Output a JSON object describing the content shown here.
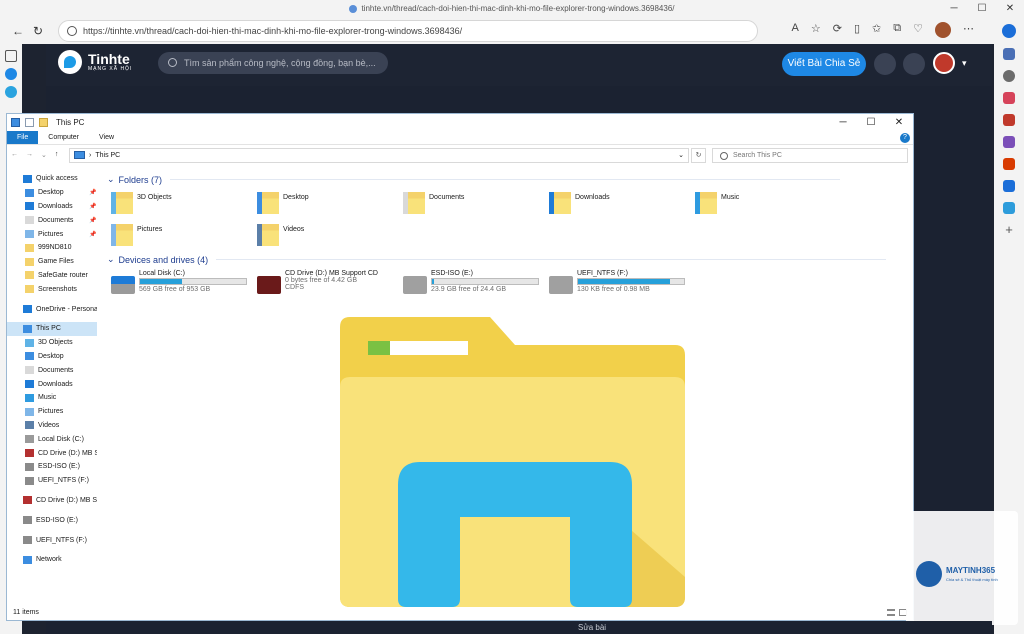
{
  "browser": {
    "tab_url_title": "tinhte.vn/thread/cach-doi-hien-thi-mac-dinh-khi-mo-file-explorer-trong-windows.3698436/",
    "address": "https://tinhte.vn/thread/cach-doi-hien-thi-mac-dinh-khi-mo-file-explorer-trong-windows.3698436/"
  },
  "site": {
    "logo_name": "Tinhte",
    "logo_tag": "MẠNG XÃ HỘI",
    "search_placeholder": "Tìm sản phẩm công nghệ, cộng đồng, bạn bè,...",
    "share_button": "Viết Bài Chia Sẻ",
    "bottom_text": "Sửa bài",
    "accent": "#1e88e5"
  },
  "explorer": {
    "title": "This PC",
    "ribbon_tabs": [
      "File",
      "Computer",
      "View"
    ],
    "help": "?",
    "path": "This PC",
    "search_placeholder": "Search This PC",
    "nav": [
      {
        "label": "Quick access",
        "icon": "star-icon",
        "level": 0
      },
      {
        "label": "Desktop",
        "icon": "desktop-icon",
        "level": 1,
        "pinned": true
      },
      {
        "label": "Downloads",
        "icon": "download-icon",
        "level": 1,
        "pinned": true
      },
      {
        "label": "Documents",
        "icon": "document-icon",
        "level": 1,
        "pinned": true
      },
      {
        "label": "Pictures",
        "icon": "pictures-icon",
        "level": 1,
        "pinned": true
      },
      {
        "label": "999ND810",
        "icon": "folder-icon",
        "level": 1
      },
      {
        "label": "Game Files",
        "icon": "folder-icon",
        "level": 1
      },
      {
        "label": "SafeGate router",
        "icon": "folder-icon",
        "level": 1
      },
      {
        "label": "Screenshots",
        "icon": "folder-icon",
        "level": 1
      },
      {
        "label": "",
        "gap": true
      },
      {
        "label": "OneDrive - Personal",
        "icon": "cloud-icon",
        "level": 0
      },
      {
        "label": "",
        "gap": true
      },
      {
        "label": "This PC",
        "icon": "pc-icon",
        "level": 0,
        "selected": true
      },
      {
        "label": "3D Objects",
        "icon": "cube-icon",
        "level": 1
      },
      {
        "label": "Desktop",
        "icon": "desktop-icon",
        "level": 1
      },
      {
        "label": "Documents",
        "icon": "document-icon",
        "level": 1
      },
      {
        "label": "Downloads",
        "icon": "download-icon",
        "level": 1
      },
      {
        "label": "Music",
        "icon": "music-icon",
        "level": 1
      },
      {
        "label": "Pictures",
        "icon": "pictures-icon",
        "level": 1
      },
      {
        "label": "Videos",
        "icon": "video-icon",
        "level": 1
      },
      {
        "label": "Local Disk (C:)",
        "icon": "disk-icon",
        "level": 1
      },
      {
        "label": "CD Drive (D:) MB Su",
        "icon": "cd-icon",
        "level": 1
      },
      {
        "label": "ESD-ISO (E:)",
        "icon": "drive-icon",
        "level": 1
      },
      {
        "label": "UEFI_NTFS (F:)",
        "icon": "drive-icon",
        "level": 1
      },
      {
        "label": "",
        "gap": true
      },
      {
        "label": "CD Drive (D:) MB Sup",
        "icon": "cd-icon",
        "level": 0
      },
      {
        "label": "",
        "gap": true
      },
      {
        "label": "ESD-ISO (E:)",
        "icon": "drive-icon",
        "level": 0
      },
      {
        "label": "",
        "gap": true
      },
      {
        "label": "UEFI_NTFS (F:)",
        "icon": "drive-icon",
        "level": 0
      },
      {
        "label": "",
        "gap": true
      },
      {
        "label": "Network",
        "icon": "network-icon",
        "level": 0
      }
    ],
    "folders_header": "Folders (7)",
    "folders": [
      {
        "label": "3D Objects",
        "icon": "cube-icon"
      },
      {
        "label": "Desktop",
        "icon": "desktop-icon"
      },
      {
        "label": "Documents",
        "icon": "document-icon"
      },
      {
        "label": "Downloads",
        "icon": "download-icon"
      },
      {
        "label": "Music",
        "icon": "music-icon"
      },
      {
        "label": "Pictures",
        "icon": "pictures-icon"
      },
      {
        "label": "Videos",
        "icon": "video-icon"
      }
    ],
    "drives_header": "Devices and drives (4)",
    "drives": [
      {
        "label": "Local Disk (C:)",
        "free": "569 GB free of 953 GB",
        "used_fraction": 0.4,
        "icon": "windows-disk-icon"
      },
      {
        "label": "CD Drive (D:) MB Support CD",
        "free": "0 bytes free of 4.42 GB",
        "extra": "CDFS",
        "icon": "rog-cd-icon"
      },
      {
        "label": "ESD-ISO (E:)",
        "free": "23.9 GB free of 24.4 GB",
        "used_fraction": 0.02,
        "icon": "drive-icon"
      },
      {
        "label": "UEFI_NTFS (F:)",
        "free": "130 KB free of 0.98 MB",
        "used_fraction": 0.87,
        "icon": "drive-icon"
      }
    ],
    "status": "11 items"
  },
  "watermark": {
    "name": "MAYTINH365",
    "tagline": "Chia sẻ & Thủ thuật máy tính"
  }
}
